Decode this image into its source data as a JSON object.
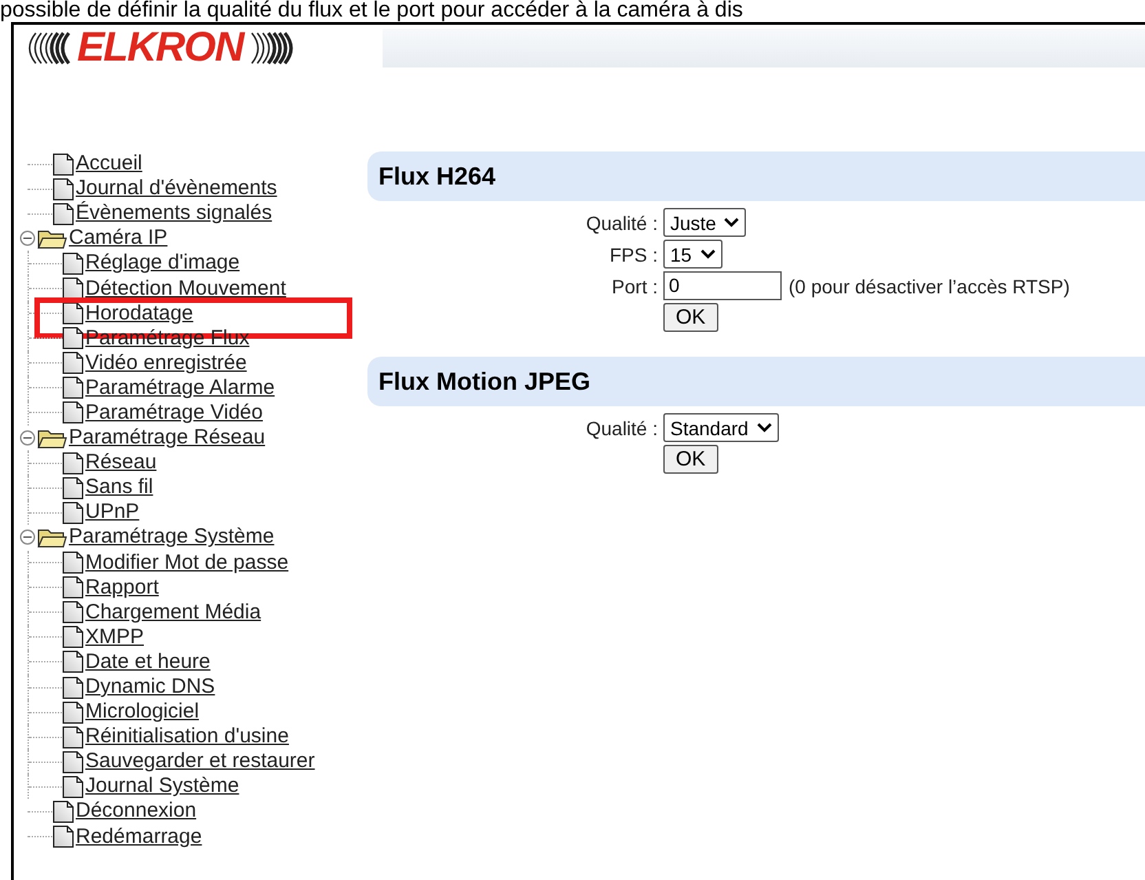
{
  "caption": "possible de définir la qualité du flux et le port pour accéder à la caméra à dis",
  "logo": {
    "text": "ELKRON"
  },
  "tree": [
    {
      "label": "Accueil"
    },
    {
      "label": "Journal d'évènements"
    },
    {
      "label": "Évènements signalés"
    },
    {
      "label": "Caméra IP",
      "expanded": true,
      "children": [
        {
          "label": "Réglage d'image"
        },
        {
          "label": "Détection Mouvement"
        },
        {
          "label": "Horodatage",
          "highlighted": true
        },
        {
          "label": "Paramétrage Flux"
        },
        {
          "label": "Vidéo enregistrée"
        },
        {
          "label": "Paramétrage Alarme"
        },
        {
          "label": "Paramétrage Vidéo"
        }
      ]
    },
    {
      "label": "Paramétrage Réseau",
      "expanded": true,
      "children": [
        {
          "label": "Réseau"
        },
        {
          "label": "Sans fil"
        },
        {
          "label": "UPnP"
        }
      ]
    },
    {
      "label": "Paramétrage Système",
      "expanded": true,
      "children": [
        {
          "label": "Modifier Mot de passe"
        },
        {
          "label": "Rapport"
        },
        {
          "label": "Chargement Média"
        },
        {
          "label": "XMPP"
        },
        {
          "label": "Date et heure"
        },
        {
          "label": "Dynamic DNS"
        },
        {
          "label": "Micrologiciel"
        },
        {
          "label": "Réinitialisation d'usine"
        },
        {
          "label": "Sauvegarder et restaurer"
        },
        {
          "label": "Journal Système"
        }
      ]
    },
    {
      "label": "Déconnexion"
    },
    {
      "label": "Redémarrage"
    }
  ],
  "sections": [
    {
      "title": "Flux H264",
      "fields": [
        {
          "kind": "select",
          "label": "Qualité :",
          "value": "Juste"
        },
        {
          "kind": "select",
          "label": "FPS :",
          "value": "15"
        },
        {
          "kind": "input",
          "label": "Port :",
          "value": "0",
          "hint": "(0 pour désactiver l’accès RTSP)"
        }
      ],
      "button": "OK"
    },
    {
      "title": "Flux Motion JPEG",
      "fields": [
        {
          "kind": "select",
          "label": "Qualité :",
          "value": "Standard"
        }
      ],
      "button": "OK"
    }
  ]
}
